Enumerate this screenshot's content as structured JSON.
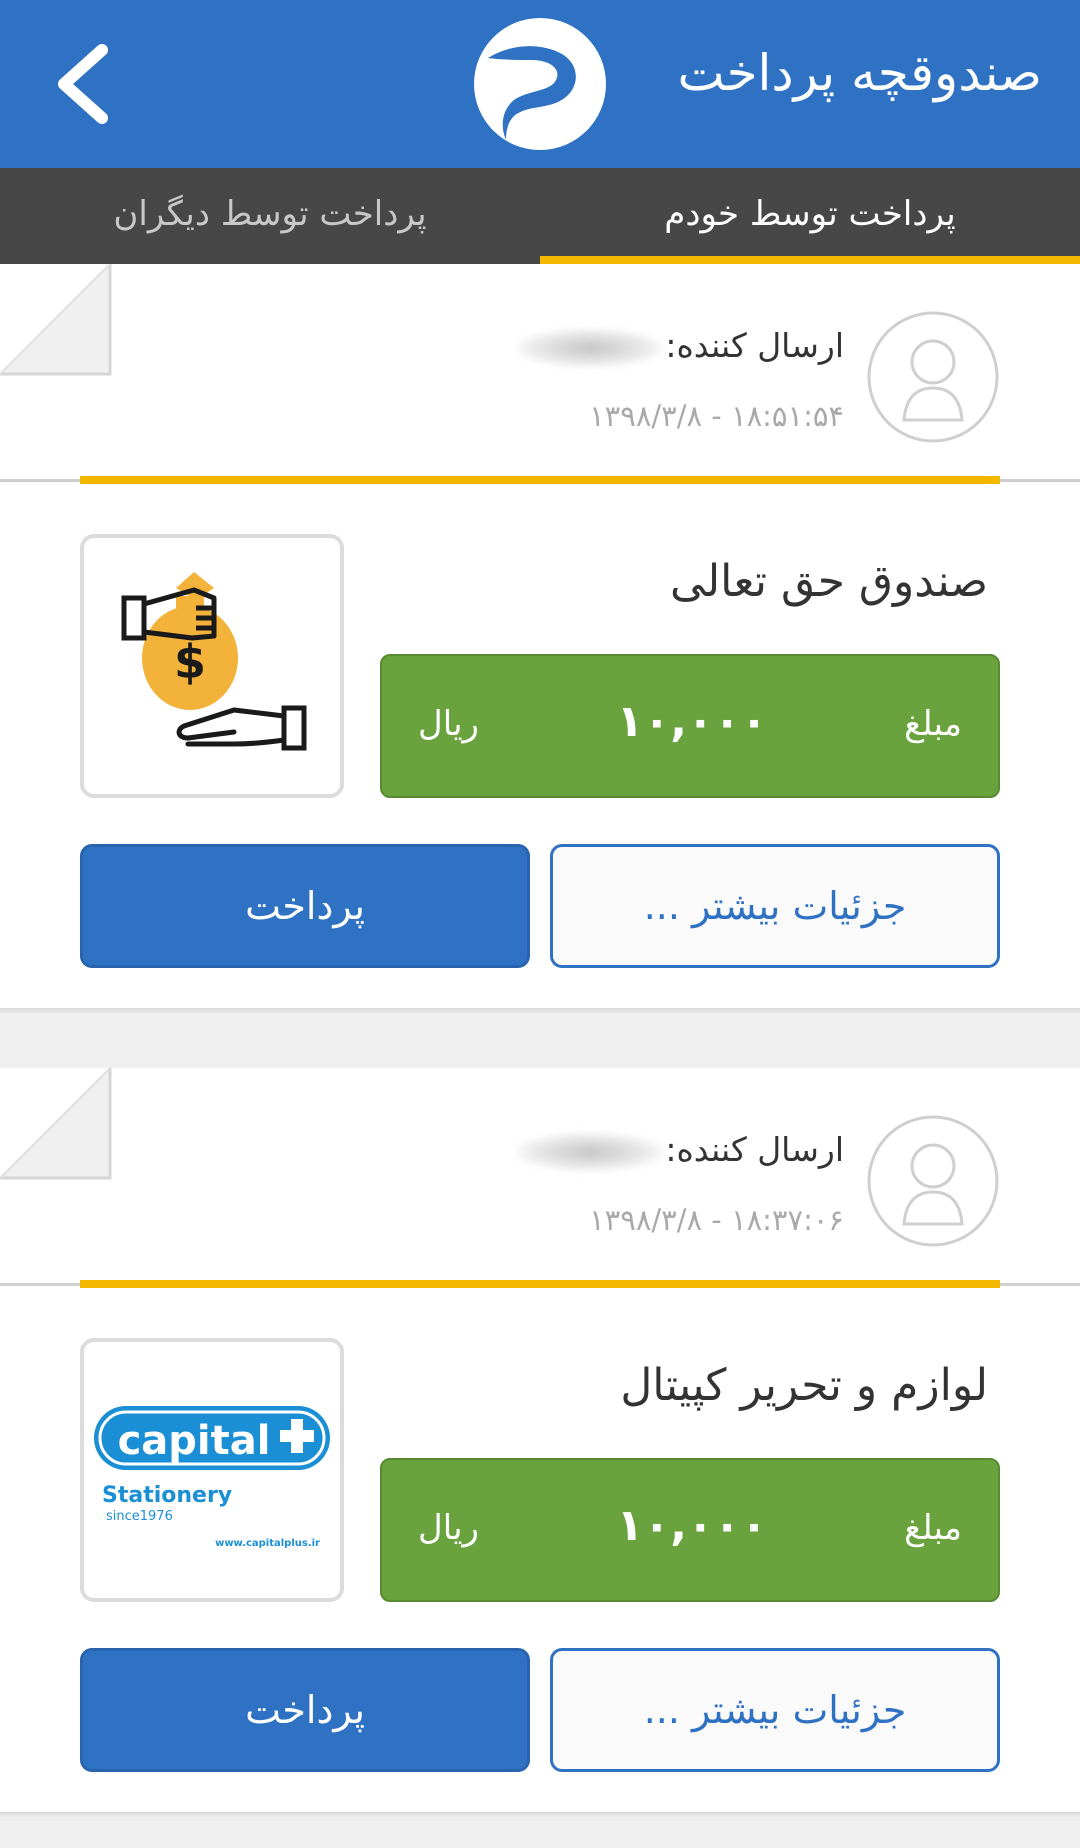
{
  "appbar": {
    "title": "صندوقچه پرداخت",
    "back_icon": "chevron-left-icon",
    "logo_icon": "app-logo-icon",
    "color": "#2f72c3"
  },
  "tabs": {
    "active": "پرداخت توسط خودم",
    "inactive": "پرداخت توسط دیگران",
    "indicator_color": "#f5b800"
  },
  "cards": [
    {
      "sender_label": "ارسال کننده:",
      "datetime": "۱۳۹۸/۳/۸ - ۱۸:۵۱:۵۴",
      "merchant": "صندوق حق تعالی",
      "amount_label": "مبلغ",
      "amount": "۱۰,۰۰۰",
      "currency": "ریال",
      "details_label": "جزئیات بیشتر ...",
      "pay_label": "پرداخت",
      "thumb_icon": "money-bag-hand-icon"
    },
    {
      "sender_label": "ارسال کننده:",
      "datetime": "۱۳۹۸/۳/۸ - ۱۸:۳۷:۰۶",
      "merchant": "لوازم و تحریر کپیتال",
      "amount_label": "مبلغ",
      "amount": "۱۰,۰۰۰",
      "currency": "ریال",
      "details_label": "جزئیات بیشتر ...",
      "pay_label": "پرداخت",
      "thumb_logo": {
        "brand": "capital",
        "line1": "Stationery",
        "line2": "since1976",
        "line3": "www.capitalplus.ir"
      }
    }
  ]
}
